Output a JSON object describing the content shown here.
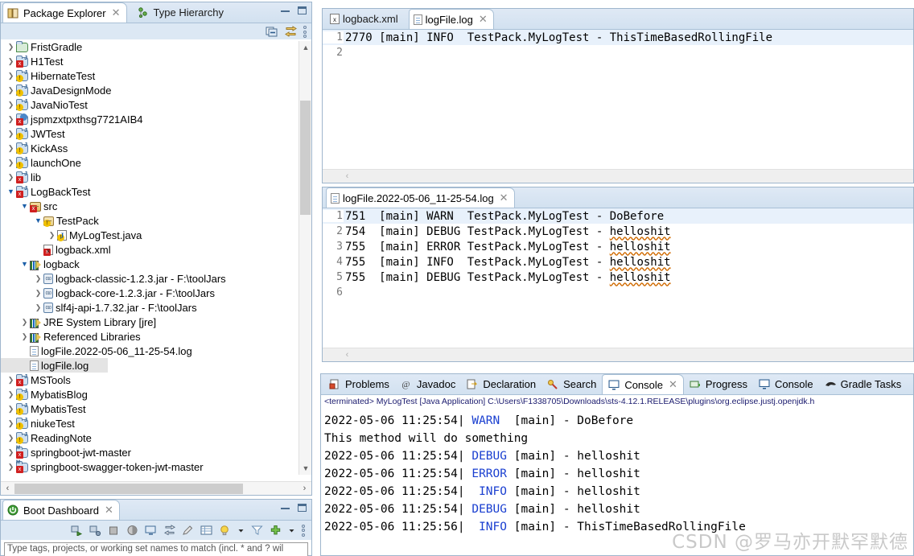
{
  "package_explorer": {
    "tabs": [
      {
        "label": "Package Explorer",
        "icon": "package-explorer-icon",
        "active": true,
        "closable": true
      },
      {
        "label": "Type Hierarchy",
        "icon": "type-hierarchy-icon",
        "active": false,
        "closable": false
      }
    ],
    "toolbar": [
      {
        "name": "collapse-all-icon"
      },
      {
        "name": "link-with-editor-icon"
      },
      {
        "name": "view-menu-icon"
      }
    ],
    "tree": [
      {
        "label": "FristGradle",
        "indent": 0,
        "arrow": "collapsed",
        "icon": "gradle-project-icon",
        "badge": ""
      },
      {
        "label": "H1Test",
        "indent": 0,
        "arrow": "collapsed",
        "icon": "java-project-icon",
        "badge": "error"
      },
      {
        "label": "HibernateTest",
        "indent": 0,
        "arrow": "collapsed",
        "icon": "java-project-icon",
        "badge": "warning"
      },
      {
        "label": "JavaDesignMode",
        "indent": 0,
        "arrow": "collapsed",
        "icon": "java-project-icon",
        "badge": "warning"
      },
      {
        "label": "JavaNioTest",
        "indent": 0,
        "arrow": "collapsed",
        "icon": "java-project-icon",
        "badge": "warning"
      },
      {
        "label": "jspmzxtpxthsg7721AIB4",
        "indent": 0,
        "arrow": "collapsed",
        "icon": "web-project-icon",
        "badge": "error"
      },
      {
        "label": "JWTest",
        "indent": 0,
        "arrow": "collapsed",
        "icon": "java-project-icon",
        "badge": "warning"
      },
      {
        "label": "KickAss",
        "indent": 0,
        "arrow": "collapsed",
        "icon": "java-project-icon",
        "badge": "warning"
      },
      {
        "label": "launchOne",
        "indent": 0,
        "arrow": "collapsed",
        "icon": "java-project-icon",
        "badge": "warning"
      },
      {
        "label": "lib",
        "indent": 0,
        "arrow": "collapsed",
        "icon": "java-project-icon",
        "badge": "error"
      },
      {
        "label": "LogBackTest",
        "indent": 0,
        "arrow": "expanded",
        "icon": "java-project-icon",
        "badge": "error"
      },
      {
        "label": "src",
        "indent": 1,
        "arrow": "expanded",
        "icon": "source-folder-icon",
        "badge": "error"
      },
      {
        "label": "TestPack",
        "indent": 2,
        "arrow": "expanded",
        "icon": "package-icon",
        "badge": "warning"
      },
      {
        "label": "MyLogTest.java",
        "indent": 3,
        "arrow": "collapsed",
        "icon": "java-file-icon",
        "badge": "warning"
      },
      {
        "label": "logback.xml",
        "indent": 2,
        "arrow": "none",
        "icon": "xml-file-icon",
        "badge": "error"
      },
      {
        "label": "logback",
        "indent": 1,
        "arrow": "expanded",
        "icon": "library-icon",
        "badge": ""
      },
      {
        "label": "logback-classic-1.2.3.jar - F:\\toolJars",
        "indent": 2,
        "arrow": "collapsed",
        "icon": "jar-icon",
        "badge": ""
      },
      {
        "label": "logback-core-1.2.3.jar - F:\\toolJars",
        "indent": 2,
        "arrow": "collapsed",
        "icon": "jar-icon",
        "badge": ""
      },
      {
        "label": "slf4j-api-1.7.32.jar - F:\\toolJars",
        "indent": 2,
        "arrow": "collapsed",
        "icon": "jar-icon",
        "badge": ""
      },
      {
        "label": "JRE System Library [jre]",
        "indent": 1,
        "arrow": "collapsed",
        "icon": "library-icon",
        "badge": ""
      },
      {
        "label": "Referenced Libraries",
        "indent": 1,
        "arrow": "collapsed",
        "icon": "library-icon",
        "badge": ""
      },
      {
        "label": "logFile.2022-05-06_11-25-54.log",
        "indent": 1,
        "arrow": "none",
        "icon": "file-icon",
        "badge": ""
      },
      {
        "label": "logFile.log",
        "indent": 1,
        "arrow": "none",
        "icon": "file-icon",
        "badge": "",
        "selected": true
      },
      {
        "label": "MSTools",
        "indent": 0,
        "arrow": "collapsed",
        "icon": "java-project-icon",
        "badge": "error"
      },
      {
        "label": "MybatisBlog",
        "indent": 0,
        "arrow": "collapsed",
        "icon": "java-project-icon",
        "badge": "warning"
      },
      {
        "label": "MybatisTest",
        "indent": 0,
        "arrow": "collapsed",
        "icon": "java-project-icon",
        "badge": "warning"
      },
      {
        "label": "niukeTest",
        "indent": 0,
        "arrow": "collapsed",
        "icon": "java-project-icon",
        "badge": "warning"
      },
      {
        "label": "ReadingNote",
        "indent": 0,
        "arrow": "collapsed",
        "icon": "java-project-icon",
        "badge": "warning"
      },
      {
        "label": "springboot-jwt-master",
        "indent": 0,
        "arrow": "collapsed",
        "icon": "maven-project-icon",
        "badge": "error"
      },
      {
        "label": "springboot-swagger-token-jwt-master",
        "indent": 0,
        "arrow": "collapsed",
        "icon": "maven-project-icon",
        "badge": "error"
      }
    ]
  },
  "editor_top": {
    "tabs": [
      {
        "label": "logback.xml",
        "icon": "xml-file-icon",
        "active": false,
        "closable": false
      },
      {
        "label": "logFile.log",
        "icon": "file-icon",
        "active": true,
        "closable": true
      }
    ],
    "lines": [
      {
        "no": "1",
        "text": "2770 [main] INFO  TestPack.MyLogTest - ThisTimeBasedRollingFile",
        "highlight": true
      },
      {
        "no": "2",
        "text": "",
        "highlight": false
      }
    ]
  },
  "editor_bottom": {
    "tabs": [
      {
        "label": "logFile.2022-05-06_11-25-54.log",
        "icon": "file-icon",
        "active": true,
        "closable": true
      }
    ],
    "lines": [
      {
        "no": "1",
        "text": "751  [main] WARN  TestPack.MyLogTest - DoBefore",
        "highlight": true,
        "spell": ""
      },
      {
        "no": "2",
        "text": "754  [main] DEBUG TestPack.MyLogTest - ",
        "highlight": false,
        "spell": "helloshit"
      },
      {
        "no": "3",
        "text": "755  [main] ERROR TestPack.MyLogTest - ",
        "highlight": false,
        "spell": "helloshit"
      },
      {
        "no": "4",
        "text": "755  [main] INFO  TestPack.MyLogTest - ",
        "highlight": false,
        "spell": "helloshit"
      },
      {
        "no": "5",
        "text": "755  [main] DEBUG TestPack.MyLogTest - ",
        "highlight": false,
        "spell": "helloshit"
      },
      {
        "no": "6",
        "text": "",
        "highlight": false,
        "spell": ""
      }
    ]
  },
  "console_panel": {
    "tabs": [
      {
        "label": "Problems",
        "icon": "problems-icon",
        "active": false,
        "closable": false
      },
      {
        "label": "Javadoc",
        "icon": "javadoc-icon",
        "active": false,
        "closable": false
      },
      {
        "label": "Declaration",
        "icon": "declaration-icon",
        "active": false,
        "closable": false
      },
      {
        "label": "Search",
        "icon": "search-icon",
        "active": false,
        "closable": false
      },
      {
        "label": "Console",
        "icon": "console-icon",
        "active": true,
        "closable": true
      },
      {
        "label": "Progress",
        "icon": "progress-icon",
        "active": false,
        "closable": false
      },
      {
        "label": "Console",
        "icon": "console-icon",
        "active": false,
        "closable": false
      },
      {
        "label": "Gradle Tasks",
        "icon": "gradle-icon",
        "active": false,
        "closable": false
      }
    ],
    "process_header": "<terminated> MyLogTest [Java Application] C:\\Users\\F1338705\\Downloads\\sts-4.12.1.RELEASE\\plugins\\org.eclipse.justj.openjdk.h",
    "lines": [
      {
        "time": "2022-05-06 11:25:54",
        "level": "WARN ",
        "rest": " [main] - DoBefore",
        "plain": ""
      },
      {
        "time": "",
        "level": "",
        "rest": "",
        "plain": "This method will do something"
      },
      {
        "time": "2022-05-06 11:25:54",
        "level": "DEBUG",
        "rest": " [main] - helloshit",
        "plain": ""
      },
      {
        "time": "2022-05-06 11:25:54",
        "level": "ERROR",
        "rest": " [main] - helloshit",
        "plain": ""
      },
      {
        "time": "2022-05-06 11:25:54",
        "level": " INFO",
        "rest": " [main] - helloshit",
        "plain": ""
      },
      {
        "time": "2022-05-06 11:25:54",
        "level": "DEBUG",
        "rest": " [main] - helloshit",
        "plain": ""
      },
      {
        "time": "2022-05-06 11:25:56",
        "level": " INFO",
        "rest": " [main] - ThisTimeBasedRollingFile",
        "plain": ""
      }
    ]
  },
  "boot_dashboard": {
    "tabs": [
      {
        "label": "Boot Dashboard",
        "icon": "boot-dashboard-icon",
        "active": true,
        "closable": true
      }
    ],
    "toolbar": [
      {
        "name": "start-icon"
      },
      {
        "name": "debug-icon"
      },
      {
        "name": "stop-icon"
      },
      {
        "name": "redeploy-icon"
      },
      {
        "name": "open-console-icon"
      },
      {
        "name": "open-browser-icon"
      },
      {
        "name": "edit-icon"
      },
      {
        "name": "properties-icon"
      },
      {
        "name": "lightbulb-icon"
      },
      {
        "name": "chevron-down-icon"
      },
      {
        "name": "filter-icon"
      },
      {
        "name": "add-icon"
      },
      {
        "name": "chevron-down-icon"
      },
      {
        "name": "view-menu-icon"
      }
    ],
    "filter_placeholder": "Type tags, projects, or working set names to match (incl. * and ? wil"
  },
  "watermark": "CSDN @罗马亦开默罕默德",
  "colors": {
    "accent": "#1a3fd0",
    "tab_active_bg": "#ffffff",
    "panel_bg": "#dce8f4",
    "selection": "#e8f1fb",
    "tree_selection": "#e4e4e4"
  }
}
